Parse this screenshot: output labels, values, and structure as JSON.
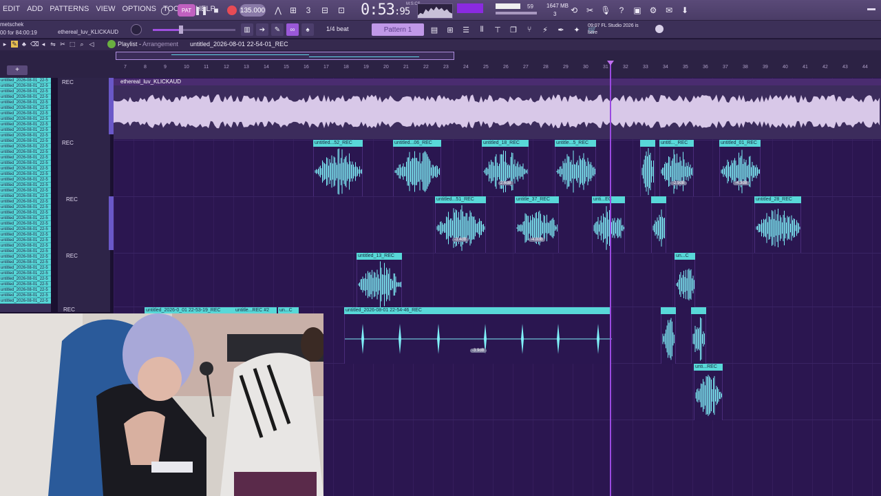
{
  "menu": [
    "EDIT",
    "ADD",
    "PATTERNS",
    "VIEW",
    "OPTIONS",
    "TOOLS",
    "HELP"
  ],
  "transport": {
    "pat_label": "PAT",
    "tempo": "135.000",
    "time_main": "0:53",
    "time_sub": "95",
    "time_units": "M:S:CS",
    "cpu": "59",
    "ram": "1647 MB",
    "polyphony": "3"
  },
  "hint": {
    "line1": "metschek",
    "line2": "00 for 84:00:19",
    "project": "ethereal_luv_KLICKAUD"
  },
  "snap_label": "1/4 beat",
  "pattern_label": "Pattern 1",
  "news": {
    "line1": "09:07  FL Studio 2026 is",
    "line2": "here"
  },
  "playlist": {
    "title": "Playlist",
    "subtitle": "Arrangement",
    "file": "untitled_2026-08-01 22-54-01_REC"
  },
  "ruler": [
    "7",
    "8",
    "9",
    "10",
    "11",
    "12",
    "13",
    "14",
    "15",
    "16",
    "17",
    "18",
    "19",
    "20",
    "21",
    "22",
    "23",
    "24",
    "25",
    "26",
    "27",
    "28",
    "29",
    "30",
    "31",
    "32",
    "33",
    "34",
    "35",
    "36",
    "37",
    "38",
    "39",
    "40",
    "41",
    "42",
    "43",
    "44"
  ],
  "tracklist": [
    "untitled_2026-08-01_22-5",
    "untitled_2026-08-01_22-5",
    "untitled_2026-08-01_22-5",
    "untitled_2026-08-01_22-5",
    "untitled_2026-08-01_22-5",
    "untitled_2026-08-01_22-5",
    "untitled_2026-08-01_22-5",
    "untitled_2026-08-01_22-5",
    "untitled_2026-08-01_22-5",
    "untitled_2026-08-01_22-5",
    "untitled_2026-08-01_22-5",
    "untitled_2026-08-01_22-5",
    "untitled_2026-08-01_22-5",
    "untitled_2026-08-01_22-5",
    "untitled_2026-08-01_22-5",
    "untitled_2026-08-01_22-5",
    "untitled_2026-08-01_22-5",
    "untitled_2026-08-01_22-5",
    "untitled_2026-08-01_22-5",
    "untitled_2026-08-01_22-5",
    "untitled_2026-08-01_22-5",
    "untitled_2026-08-01_22-5",
    "untitled_2026-08-01_22-5",
    "untitled_2026-08-01_22-5",
    "untitled_2026-08-01_22-5",
    "untitled_2026-08-01_22-5",
    "untitled_2026-08-01_22-5",
    "untitled_2026-08-01_22-5",
    "untitled_2026-08-01_22-5",
    "untitled_2026-08-01_22-5",
    "untitled_2026-08-01_22-5",
    "untitled_2026-08-01_22-5",
    "untitled_2026-08-01_22-5",
    "untitled_2026-08-01_22-5",
    "untitled_2026-08-01_22-5",
    "untitled_2026-08-01_22-5",
    "untitled_2026-08-01_22-5",
    "untitled_2026-08-01_22-5",
    "untitled_2026-08-01_22-5",
    "untitled_2026-08-01_22-5",
    "untitled_2026-08-01_22-5"
  ],
  "track_headers": [
    "REC",
    "REC",
    "REC",
    "REC",
    "REC"
  ],
  "main_clip": "ethereal_luv_KLICKAUD",
  "clips": {
    "c1": "untitled...52_REC",
    "c2": "untitled...06_REC",
    "c3": "untitled_18_REC",
    "c4": "untitle...5_REC",
    "c5": "untitl..._REC",
    "c6": "untitled_01_REC",
    "c7": "untitled...51_REC",
    "c8": "untitle_37_REC",
    "c9": "unti...EC",
    "c10": "untitled_28_REC",
    "c11": "untitled_13_REC",
    "c12": "un...C",
    "c13": "untitled_2026-0_01 22-53-19_REC",
    "c14": "untitle...REC #2",
    "c15": "un...C",
    "c16": "untitled_2026-08-01 22-54-46_REC",
    "c17": "unti...REC"
  },
  "volumes": {
    "v1": "2.6dB",
    "v2": "-2.9dB",
    "v3": "-4.3dB",
    "v4": "-3.4dB",
    "v5": "-4.8dB",
    "v6": "-3.9dB"
  },
  "colors": {
    "clip": "#58d8d8",
    "lane": "#2b1650",
    "playhead": "#9a4ae0",
    "accent": "#a050e0"
  }
}
